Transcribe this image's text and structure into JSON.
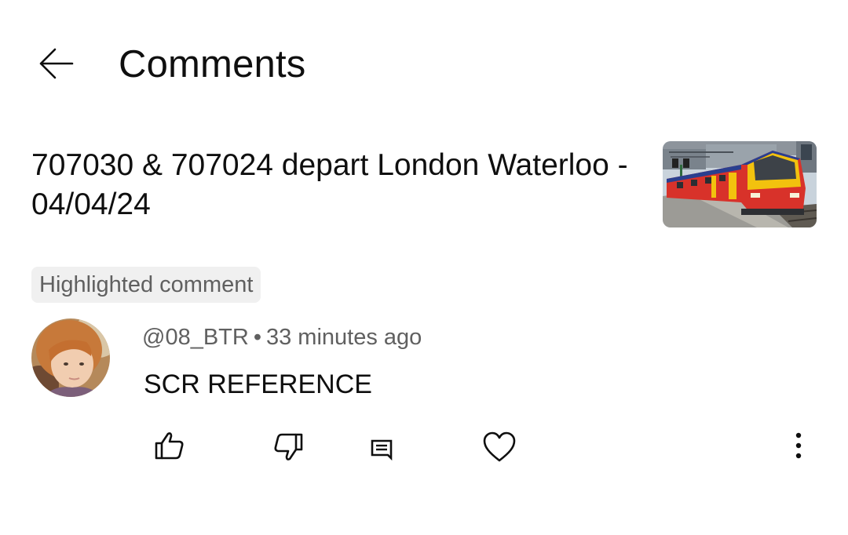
{
  "header": {
    "title": "Comments",
    "back_icon": "arrow-left-icon"
  },
  "video": {
    "title": "707030 & 707024 depart London Waterloo - 04/04/24",
    "thumbnail_icon": "train-thumbnail"
  },
  "highlight_label": "Highlighted comment",
  "comment": {
    "author": "@08_BTR",
    "separator": "•",
    "time": "33 minutes ago",
    "text": "SCR REFERENCE",
    "avatar_icon": "user-avatar"
  },
  "actions": {
    "like_icon": "thumbs-up-icon",
    "dislike_icon": "thumbs-down-icon",
    "reply_icon": "reply-comment-icon",
    "heart_icon": "heart-icon",
    "more_icon": "more-vertical-icon"
  },
  "colors": {
    "text_primary": "#0f0f0f",
    "text_secondary": "#606060",
    "chip_bg": "#f0f0f0",
    "train_red": "#d8322a",
    "train_yellow": "#f2c20e",
    "train_blue": "#2a3f8f"
  }
}
